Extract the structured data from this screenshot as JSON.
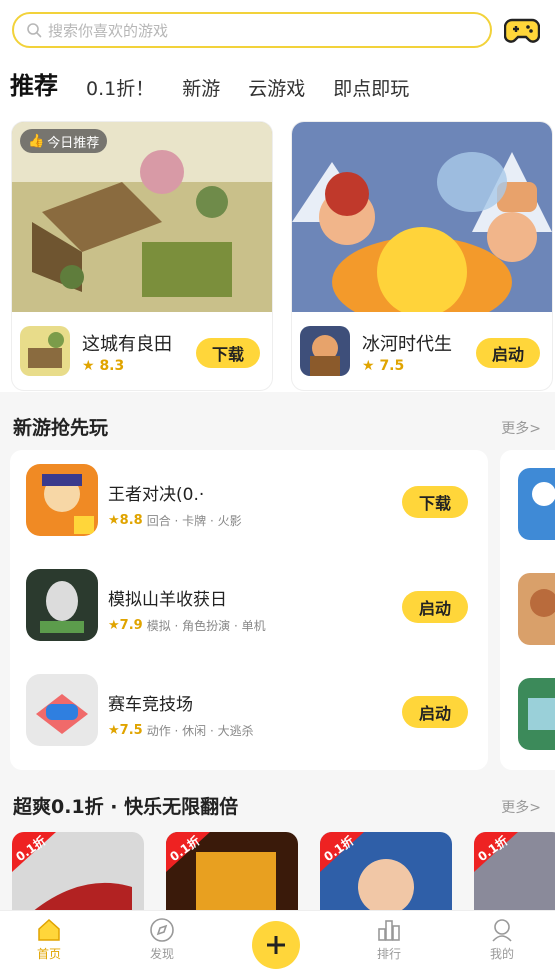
{
  "search": {
    "placeholder": "搜索你喜欢的游戏"
  },
  "tabs": [
    {
      "label": "推荐",
      "active": true
    },
    {
      "label": "0.1折！"
    },
    {
      "label": "新游"
    },
    {
      "label": "云游戏"
    },
    {
      "label": "即点即玩"
    }
  ],
  "featured": [
    {
      "badge": "今日推荐",
      "name": "这城有良田",
      "rating": "8.3",
      "button": "下载"
    },
    {
      "name": "冰河时代生",
      "rating": "7.5",
      "button": "启动"
    }
  ],
  "new_games": {
    "title": "新游抢先玩",
    "more": "更多>",
    "items": [
      {
        "name": "王者对决(0.·",
        "rating": "8.8",
        "tags": "回合 · 卡牌 · 火影",
        "button": "下载"
      },
      {
        "name": "模拟山羊收获日",
        "rating": "7.9",
        "tags": "模拟 · 角色扮演 · 单机",
        "button": "启动"
      },
      {
        "name": "赛车竞技场",
        "rating": "7.5",
        "tags": "动作 · 休闲 · 大逃杀",
        "button": "启动"
      }
    ]
  },
  "discount": {
    "title": "超爽0.1折 · 快乐无限翻倍",
    "more": "更多>",
    "tag": "0.1折"
  },
  "nav": [
    {
      "label": "首页",
      "icon": "home-icon",
      "active": true
    },
    {
      "label": "发现",
      "icon": "compass-icon"
    },
    {
      "label": "",
      "icon": "plus-icon"
    },
    {
      "label": "排行",
      "icon": "ranking-icon"
    },
    {
      "label": "我的",
      "icon": "profile-icon"
    }
  ],
  "colors": {
    "accent": "#ffd63a",
    "rating": "#e0a400"
  }
}
